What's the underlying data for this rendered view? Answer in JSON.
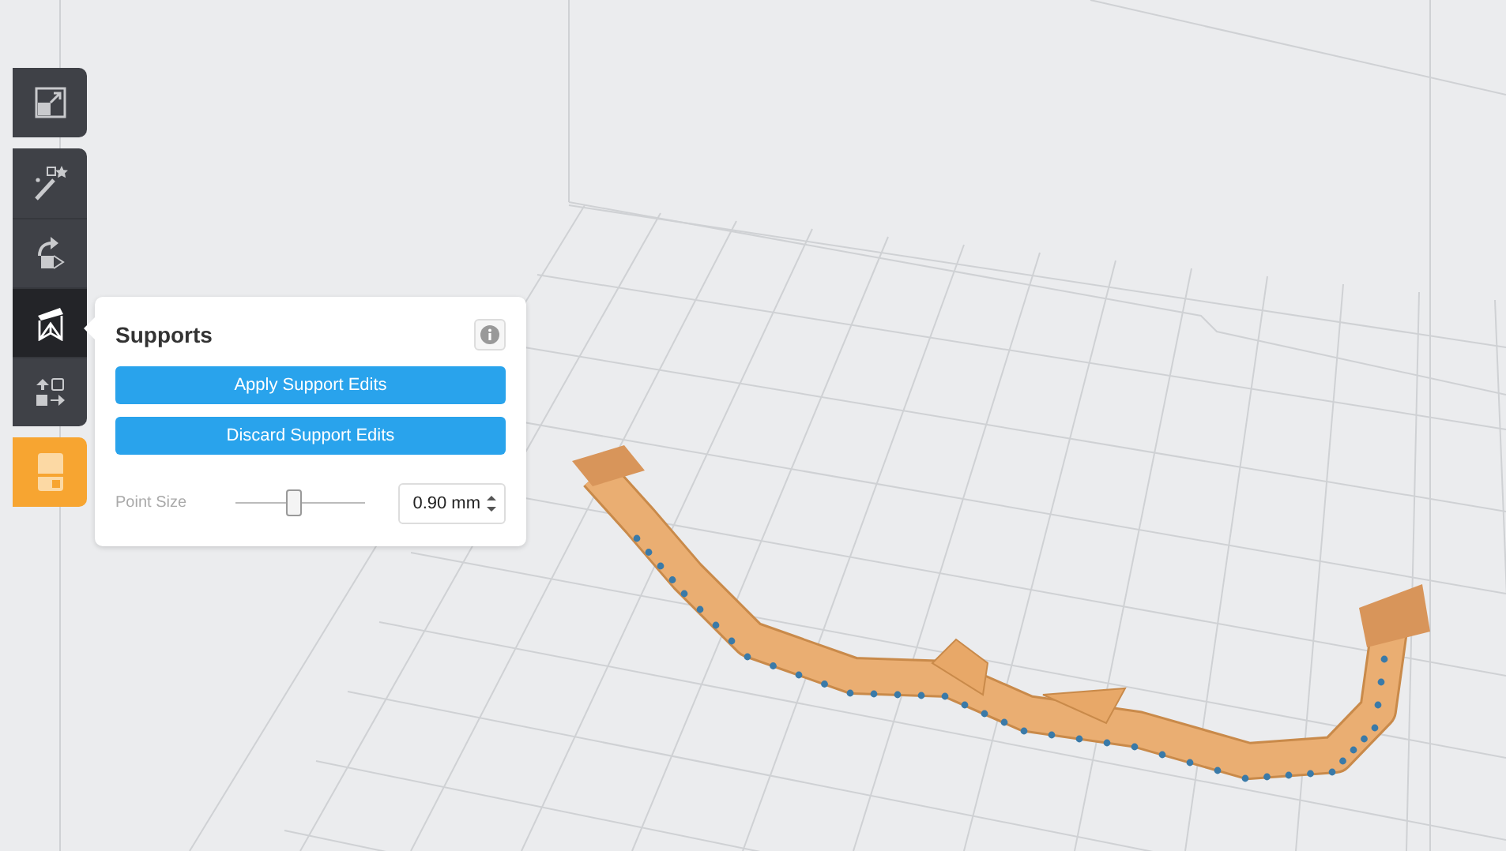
{
  "toolbar": {
    "groups": [
      {
        "tools": [
          {
            "kind": "scale",
            "selected": false
          }
        ]
      },
      {
        "tools": [
          {
            "kind": "magic",
            "selected": false
          },
          {
            "kind": "rotate",
            "selected": false
          },
          {
            "kind": "supports",
            "selected": true
          },
          {
            "kind": "arrange",
            "selected": false
          }
        ]
      },
      {
        "tools": [
          {
            "kind": "print",
            "selected": false
          }
        ]
      }
    ]
  },
  "panel": {
    "title": "Supports",
    "buttons": [
      "Apply Support Edits",
      "Discard Support Edits"
    ],
    "point_size": {
      "label": "Point Size",
      "level": 0.45,
      "value": "0.90 mm"
    }
  }
}
